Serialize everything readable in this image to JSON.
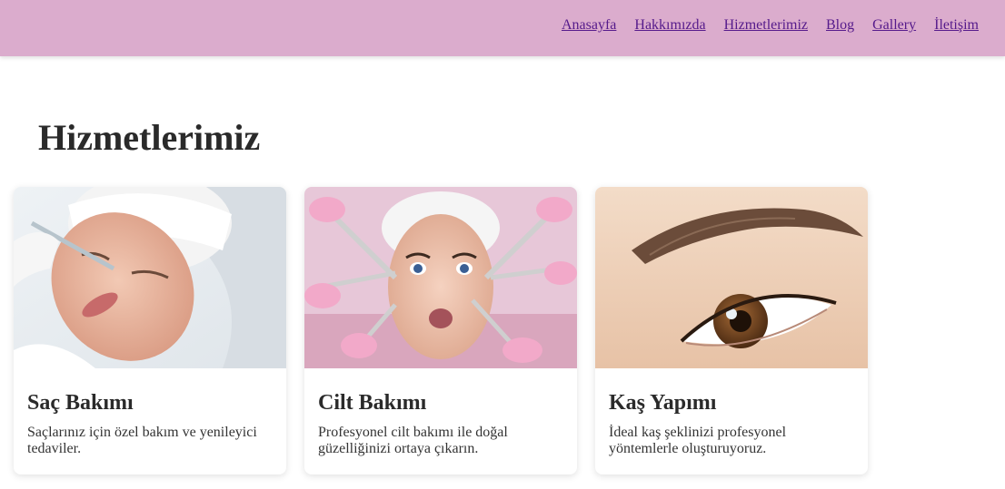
{
  "nav": {
    "items": [
      {
        "label": "Anasayfa"
      },
      {
        "label": "Hakkımızda"
      },
      {
        "label": "Hizmetlerimiz"
      },
      {
        "label": "Blog"
      },
      {
        "label": "Gallery"
      },
      {
        "label": "İletişim"
      }
    ]
  },
  "colors": {
    "header_bg": "#dbaccd",
    "link": "#551a8b",
    "text": "#2a2a2a"
  },
  "services": {
    "title": "Hizmetlerimiz",
    "cards": [
      {
        "title": "Saç Bakımı",
        "description": "Saçlarınız için özel bakım ve yenileyici tedaviler.",
        "image": "face-injection-treatment-photo"
      },
      {
        "title": "Cilt Bakımı",
        "description": "Profesyonel cilt bakımı ile doğal güzelliğinizi ortaya çıkarın.",
        "image": "facial-skin-treatment-photo"
      },
      {
        "title": "Kaş Yapımı",
        "description": "İdeal kaş şeklinizi profesyonel yöntemlerle oluşturuyoruz.",
        "image": "eyebrow-closeup-photo"
      }
    ]
  }
}
